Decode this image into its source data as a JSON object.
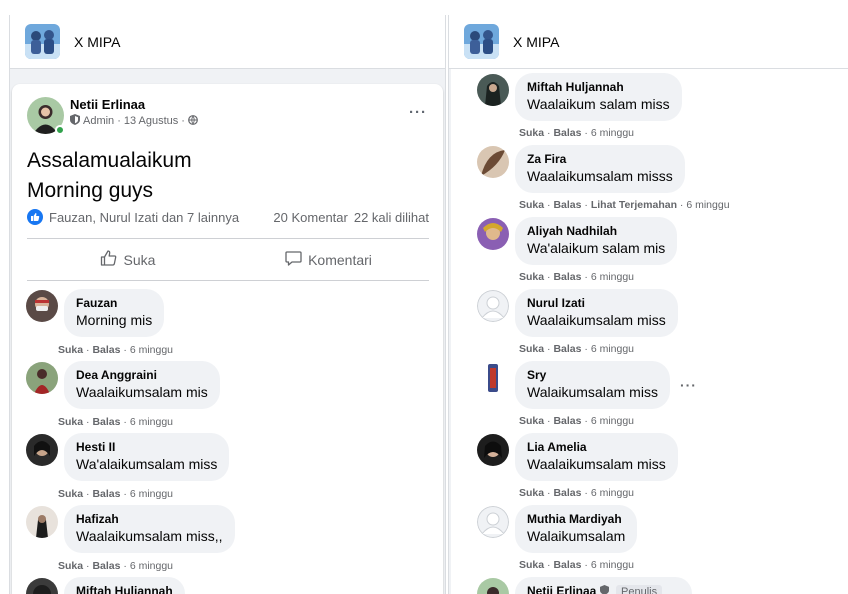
{
  "group": {
    "name": "X MIPA"
  },
  "post": {
    "author": "Netii Erlinaa",
    "role": "Admin",
    "date": "13 Agustus",
    "more": "···",
    "lines": [
      "Assalamualaikum",
      "Morning guys"
    ],
    "reactions_text": "Fauzan, Nurul Izati dan 7 lainnya",
    "comment_count": "20 Komentar",
    "view_count": "22 kali dilihat",
    "like_label": "Suka",
    "comment_label": "Komentari"
  },
  "left_comments": [
    {
      "name": "Fauzan",
      "text": "Morning mis",
      "actions": [
        "Suka",
        "Balas"
      ],
      "time": "6 minggu"
    },
    {
      "name": "Dea Anggraini",
      "text": "Waalaikumsalam mis",
      "actions": [
        "Suka",
        "Balas"
      ],
      "time": "6 minggu"
    },
    {
      "name": "Hesti II",
      "text": "Wa'alaikumsalam miss",
      "actions": [
        "Suka",
        "Balas"
      ],
      "time": "6 minggu"
    },
    {
      "name": "Hafizah",
      "text": "Waalaikumsalam miss,,",
      "actions": [
        "Suka",
        "Balas"
      ],
      "time": "6 minggu"
    },
    {
      "name": "Miftah Huljannah",
      "text": "",
      "actions": [],
      "time": ""
    }
  ],
  "right_comments": [
    {
      "name": "Miftah Huljannah",
      "text": "Waalaikum salam miss",
      "actions": [
        "Suka",
        "Balas"
      ],
      "time": "6 minggu"
    },
    {
      "name": "Za Fira",
      "text": "Waalaikumsalam misss",
      "actions": [
        "Suka",
        "Balas",
        "Lihat Terjemahan"
      ],
      "time": "6 minggu"
    },
    {
      "name": "Aliyah Nadhilah",
      "text": "Wa'alaikum salam mis",
      "actions": [
        "Suka",
        "Balas"
      ],
      "time": "6 minggu"
    },
    {
      "name": "Nurul Izati",
      "text": "Waalaikumsalam miss",
      "actions": [
        "Suka",
        "Balas"
      ],
      "time": "6 minggu"
    },
    {
      "name": "Sry",
      "text": "Walaikumsalam miss",
      "actions": [
        "Suka",
        "Balas"
      ],
      "time": "6 minggu"
    },
    {
      "name": "Lia Amelia",
      "text": "Waalaikumsalam miss",
      "actions": [
        "Suka",
        "Balas"
      ],
      "time": "6 minggu"
    },
    {
      "name": "Muthia Mardiyah",
      "text": "Walaikumsalam",
      "actions": [
        "Suka",
        "Balas"
      ],
      "time": "6 minggu"
    },
    {
      "name": "Netii Erlinaa",
      "text": "",
      "actions": [],
      "time": "",
      "badge": "Penulis"
    }
  ],
  "colors": {
    "accent": "#1877f2",
    "online": "#31a24c",
    "secondary_text": "#65676b",
    "bubble": "#f0f2f5"
  },
  "icons": [
    "group-photo-icon",
    "shield-icon",
    "globe-icon",
    "more-icon",
    "like-reaction-icon",
    "thumbs-up-icon",
    "comment-icon"
  ]
}
